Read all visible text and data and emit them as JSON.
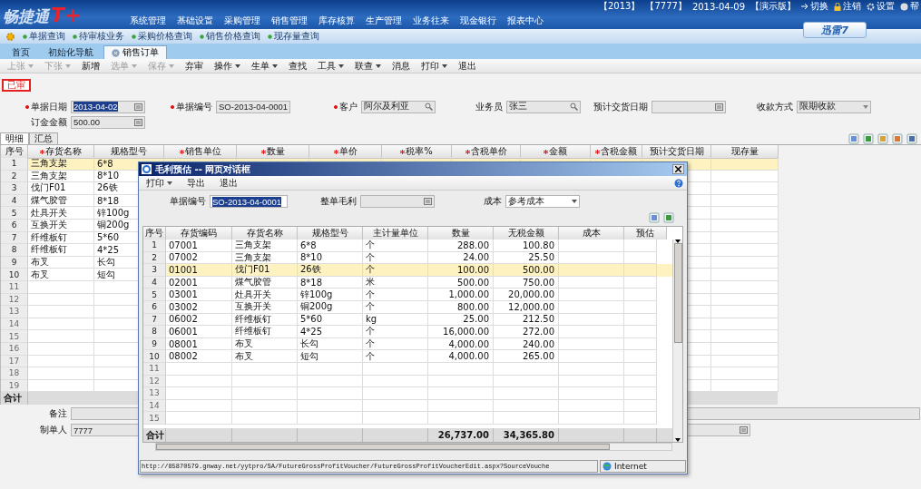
{
  "header": {
    "logo": "畅捷通",
    "logo_mark": "T+",
    "info": [
      "【2013】",
      "【7777】",
      "2013-04-09",
      "【演示版】"
    ],
    "actions": [
      "切换",
      "注销",
      "设置",
      "帮"
    ],
    "menu": [
      "系统管理",
      "基础设置",
      "采购管理",
      "销售管理",
      "库存核算",
      "生产管理",
      "业务往来",
      "现金银行",
      "报表中心"
    ]
  },
  "quick_links": [
    "单据查询",
    "待审核业务",
    "采购价格查询",
    "销售价格查询",
    "现存量查询"
  ],
  "download_badge": "迅雷7",
  "tabs": [
    {
      "label": "首页",
      "selected": false,
      "closable": false
    },
    {
      "label": "初始化导航",
      "selected": false,
      "closable": false
    },
    {
      "label": "销售订单",
      "selected": true,
      "closable": true
    }
  ],
  "toolbar": [
    {
      "label": "上张",
      "dropdown": true,
      "disabled": true
    },
    {
      "label": "下张",
      "dropdown": true,
      "disabled": true
    },
    {
      "label": "新增",
      "dropdown": false,
      "disabled": false
    },
    {
      "label": "选单",
      "dropdown": true,
      "disabled": true
    },
    {
      "label": "保存",
      "dropdown": true,
      "disabled": true
    },
    {
      "label": "弃审",
      "dropdown": false,
      "disabled": false
    },
    {
      "label": "操作",
      "dropdown": true,
      "disabled": false
    },
    {
      "label": "生单",
      "dropdown": true,
      "disabled": false
    },
    {
      "label": "查找",
      "dropdown": false,
      "disabled": false
    },
    {
      "label": "工具",
      "dropdown": true,
      "disabled": false
    },
    {
      "label": "联查",
      "dropdown": true,
      "disabled": false
    },
    {
      "label": "消息",
      "dropdown": false,
      "disabled": false
    },
    {
      "label": "打印",
      "dropdown": true,
      "disabled": false
    },
    {
      "label": "退出",
      "dropdown": false,
      "disabled": false
    }
  ],
  "status_stamp": "已审",
  "form": [
    [
      {
        "label": "单据日期",
        "required": true,
        "kind": "date",
        "value": "2013-04-02",
        "highlighted": true
      },
      {
        "label": "单据编号",
        "required": true,
        "kind": "text",
        "value": "SO-2013-04-0001",
        "highlighted": false
      },
      {
        "label": "客户",
        "required": true,
        "kind": "lookup",
        "value": "阿尔及利亚",
        "highlighted": false
      },
      {
        "label": "业务员",
        "required": false,
        "kind": "lookup",
        "value": "张三",
        "highlighted": false
      },
      {
        "label": "预计交货日期",
        "required": false,
        "kind": "date"
      },
      {
        "label": "收款方式",
        "required": false,
        "kind": "select",
        "value": "限期收款",
        "highlighted": false
      }
    ],
    [
      {
        "label": "订金金额",
        "required": false,
        "kind": "date",
        "value": "500.00",
        "highlighted": false
      }
    ]
  ],
  "sub_tabs": [
    {
      "label": "明细",
      "selected": true
    },
    {
      "label": "汇总",
      "selected": false
    }
  ],
  "table": {
    "columns": [
      {
        "label": "序号",
        "required": false
      },
      {
        "label": "存货名称",
        "required": true
      },
      {
        "label": "规格型号",
        "required": false
      },
      {
        "label": "销售单位",
        "required": true
      },
      {
        "label": "数量",
        "required": true
      },
      {
        "label": "单价",
        "required": true
      },
      {
        "label": "税率%",
        "required": true
      },
      {
        "label": "含税单价",
        "required": true
      },
      {
        "label": "金额",
        "required": true
      },
      {
        "label": "含税金额",
        "required": true
      },
      {
        "label": "预计交货日期",
        "required": false
      },
      {
        "label": "现存量",
        "required": false
      }
    ],
    "rows": [
      {
        "no": "1",
        "name": "三角支架",
        "spec": "6*8",
        "selected": true
      },
      {
        "no": "2",
        "name": "三角支架",
        "spec": "8*10",
        "selected": false
      },
      {
        "no": "3",
        "name": "伐门F01",
        "spec": "26铁",
        "selected": false
      },
      {
        "no": "4",
        "name": "煤气胶管",
        "spec": "8*18",
        "selected": false
      },
      {
        "no": "5",
        "name": "灶具开关",
        "spec": "锌100g",
        "selected": false
      },
      {
        "no": "6",
        "name": "互换开关",
        "spec": "铜200g",
        "selected": false
      },
      {
        "no": "7",
        "name": "纤维板钉",
        "spec": "5*60",
        "selected": false
      },
      {
        "no": "8",
        "name": "纤维板钉",
        "spec": "4*25",
        "selected": false
      },
      {
        "no": "9",
        "name": "布叉",
        "spec": "长勾",
        "selected": false
      },
      {
        "no": "10",
        "name": "布叉",
        "spec": "短勾",
        "selected": false
      }
    ],
    "empty_rows": [
      "11",
      "12",
      "13",
      "14",
      "15",
      "16",
      "17",
      "18",
      "19"
    ],
    "total_label": "合计"
  },
  "remarks": {
    "label": "备注"
  },
  "maker": {
    "label": "制单人",
    "value": "7777"
  },
  "dialog": {
    "title": "毛利预估 -- 网页对话框",
    "menu": [
      {
        "label": "打印",
        "dropdown": true
      },
      {
        "label": "导出",
        "dropdown": false
      },
      {
        "label": "退出",
        "dropdown": false
      }
    ],
    "doc_no": {
      "label": "单据编号",
      "value": "SO-2013-04-0001"
    },
    "gross_profit": {
      "label": "整单毛利"
    },
    "cost": {
      "label": "成本",
      "value": "参考成本"
    },
    "columns": [
      "序号",
      "存货编码",
      "存货名称",
      "规格型号",
      "主计量单位",
      "数量",
      "无税金额",
      "成本",
      "预估"
    ],
    "rows": [
      {
        "no": "1",
        "code": "07001",
        "name": "三角支架",
        "spec": "6*8",
        "unit": "个",
        "qty": "288.00",
        "amount": "100.80",
        "selected": false
      },
      {
        "no": "2",
        "code": "07002",
        "name": "三角支架",
        "spec": "8*10",
        "unit": "个",
        "qty": "24.00",
        "amount": "25.50",
        "selected": false
      },
      {
        "no": "3",
        "code": "01001",
        "name": "伐门F01",
        "spec": "26铁",
        "unit": "个",
        "qty": "100.00",
        "amount": "500.00",
        "selected": true
      },
      {
        "no": "4",
        "code": "02001",
        "name": "煤气胶管",
        "spec": "8*18",
        "unit": "米",
        "qty": "500.00",
        "amount": "750.00",
        "selected": false
      },
      {
        "no": "5",
        "code": "03001",
        "name": "灶具开关",
        "spec": "锌100g",
        "unit": "个",
        "qty": "1,000.00",
        "amount": "20,000.00",
        "selected": false
      },
      {
        "no": "6",
        "code": "03002",
        "name": "互换开关",
        "spec": "铜200g",
        "unit": "个",
        "qty": "800.00",
        "amount": "12,000.00",
        "selected": false
      },
      {
        "no": "7",
        "code": "06002",
        "name": "纤维板钉",
        "spec": "5*60",
        "unit": "kg",
        "qty": "25.00",
        "amount": "212.50",
        "selected": false
      },
      {
        "no": "8",
        "code": "06001",
        "name": "纤维板钉",
        "spec": "4*25",
        "unit": "个",
        "qty": "16,000.00",
        "amount": "272.00",
        "selected": false
      },
      {
        "no": "9",
        "code": "08001",
        "name": "布叉",
        "spec": "长勾",
        "unit": "个",
        "qty": "4,000.00",
        "amount": "240.00",
        "selected": false
      },
      {
        "no": "10",
        "code": "08002",
        "name": "布叉",
        "spec": "短勾",
        "unit": "个",
        "qty": "4,000.00",
        "amount": "265.00",
        "selected": false
      }
    ],
    "empty_rows": [
      "11",
      "12",
      "13",
      "14",
      "15"
    ],
    "total": {
      "label": "合计",
      "qty": "26,737.00",
      "amount": "34,365.80"
    },
    "status_url": "http://85870579.gnway.net/yytpro/SA/FutureGrossProfitVoucher/FutureGrossProfitVoucherEdit.aspx?SourceVouche",
    "zone": "Internet"
  }
}
